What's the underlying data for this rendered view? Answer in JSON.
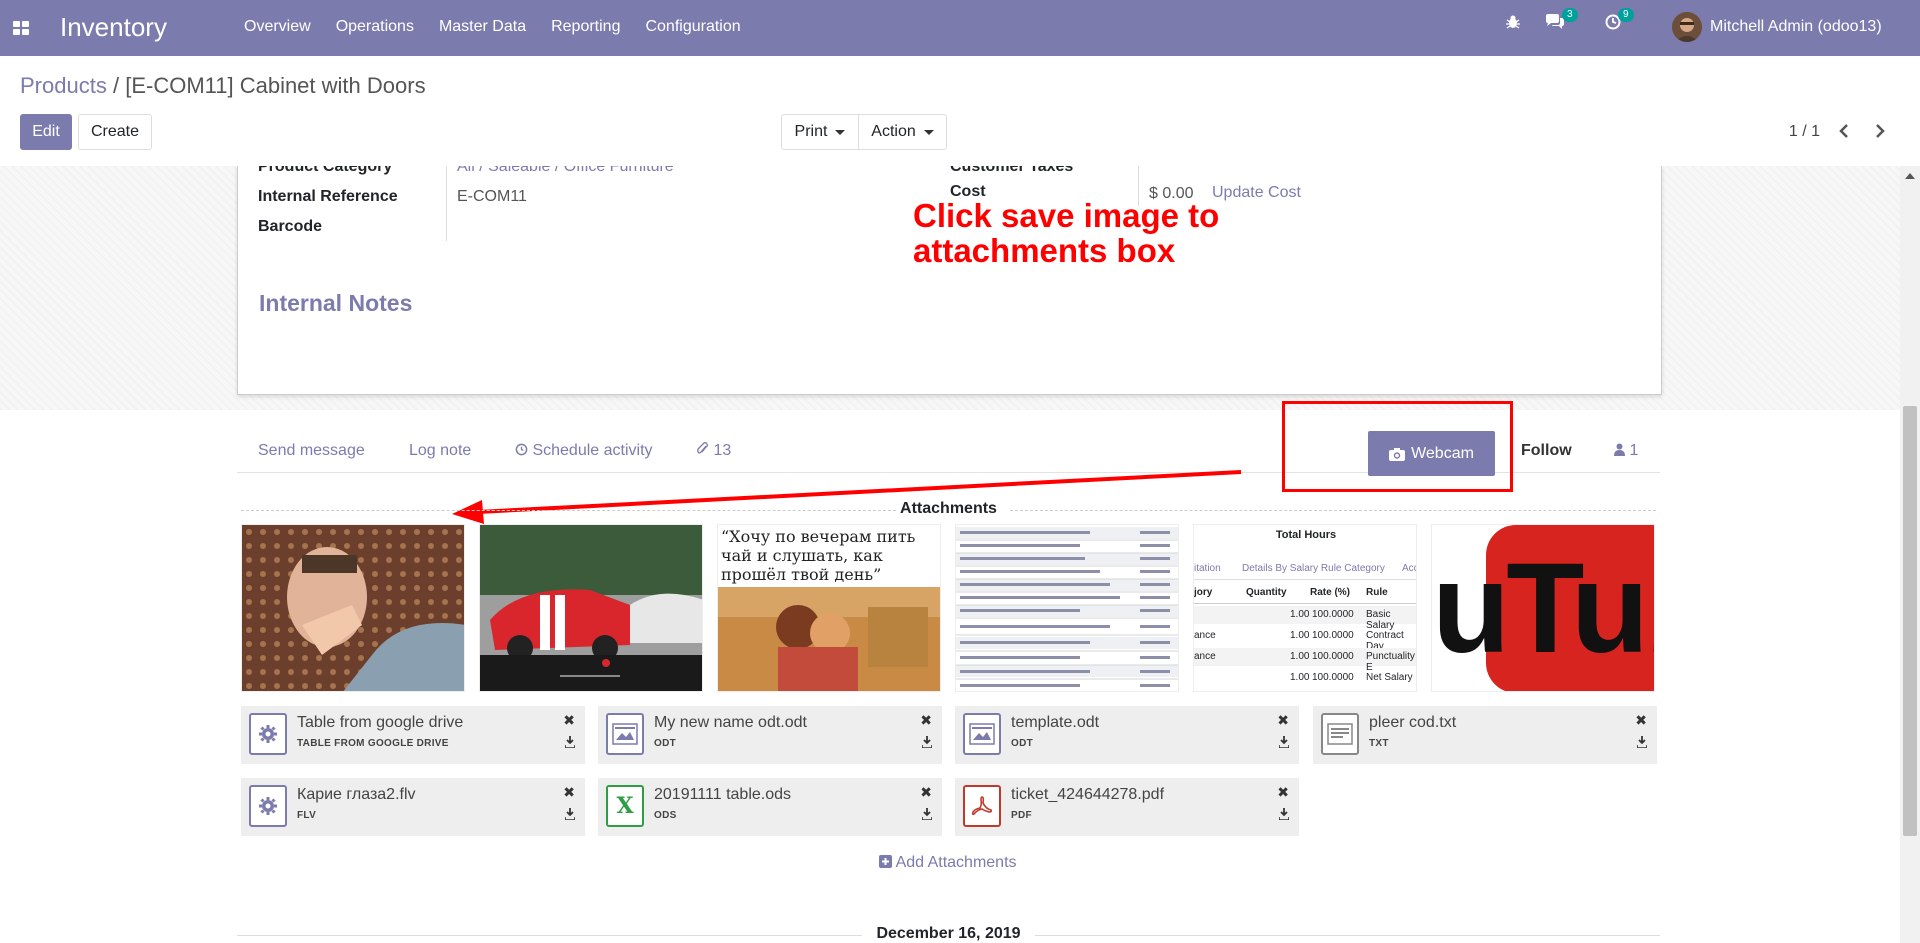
{
  "navbar": {
    "app_title": "Inventory",
    "menu": [
      "Overview",
      "Operations",
      "Master Data",
      "Reporting",
      "Configuration"
    ],
    "messages_count": "3",
    "activities_count": "9",
    "user_name": "Mitchell Admin (odoo13)"
  },
  "breadcrumb": {
    "parent": "Products",
    "separator": "/",
    "current": "[E-COM11] Cabinet with Doors"
  },
  "buttons": {
    "edit": "Edit",
    "create": "Create",
    "print": "Print",
    "action": "Action"
  },
  "pager": {
    "value": "1 / 1"
  },
  "form": {
    "product_category_label": "Product Category",
    "product_category_value": "All / Saleable / Office Furniture",
    "internal_reference_label": "Internal Reference",
    "internal_reference_value": "E-COM11",
    "barcode_label": "Barcode",
    "customer_taxes_label": "Customer Taxes",
    "cost_label": "Cost",
    "cost_value": "$ 0.00",
    "update_cost": "Update Cost",
    "internal_notes_title": "Internal Notes"
  },
  "annotation": {
    "line1": "Click save image to",
    "line2": "attachments box"
  },
  "chatter": {
    "send_message": "Send message",
    "log_note": "Log note",
    "schedule_activity": "Schedule activity",
    "attachments_count": "13",
    "webcam": "Webcam",
    "follow": "Follow",
    "followers_count": "1"
  },
  "attachments": {
    "title": "Attachments",
    "thumbnails": {
      "russian_text": "“Хочу по вечерам пить чай и слушать, как прошёл твой день”",
      "table_header": "Total Hours",
      "table_tab1": "itation",
      "table_tab2": "Details By Salary Rule Category",
      "table_tab3": "Acc",
      "table_cols": [
        "jory",
        "Quantity",
        "Rate (%)",
        "Rule"
      ],
      "table_rows": [
        [
          "",
          "1.00",
          "100.0000",
          "Basic Salary"
        ],
        [
          "ance",
          "1.00",
          "100.0000",
          "Contract Day"
        ],
        [
          "ance",
          "1.00",
          "100.0000",
          "Punctuality E"
        ],
        [
          "",
          "1.00",
          "100.0000",
          "Net Salary"
        ]
      ],
      "youtube_text": "uTub"
    },
    "files": [
      {
        "name": "Table from google drive",
        "type": "TABLE FROM GOOGLE DRIVE",
        "icon": "gear-icon"
      },
      {
        "name": "My new name odt.odt",
        "type": "ODT",
        "icon": "document-image-icon"
      },
      {
        "name": "template.odt",
        "type": "ODT",
        "icon": "document-image-icon"
      },
      {
        "name": "pleer cod.txt",
        "type": "TXT",
        "icon": "text-file-icon"
      },
      {
        "name": "Карие глаза2.flv",
        "type": "FLV",
        "icon": "gear-icon"
      },
      {
        "name": "20191111 table.ods",
        "type": "ODS",
        "icon": "spreadsheet-icon"
      },
      {
        "name": "ticket_424644278.pdf",
        "type": "PDF",
        "icon": "pdf-icon"
      }
    ],
    "add_label": "Add Attachments"
  },
  "date_separator": "December 16, 2019",
  "colors": {
    "primary": "#7c7bad",
    "annotation": "#ff0000",
    "teal": "#00a09d"
  }
}
